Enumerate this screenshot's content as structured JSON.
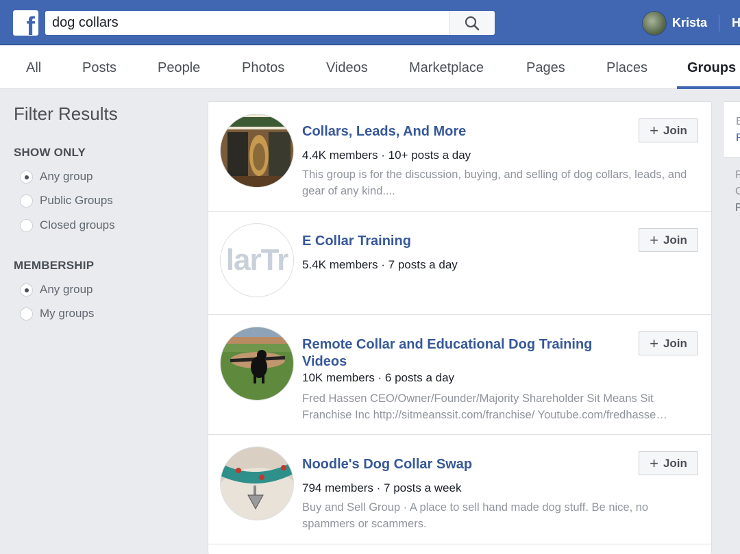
{
  "header": {
    "logo": "f",
    "search": {
      "value": "dog collars",
      "icon": "search-icon"
    },
    "user": {
      "name": "Krista"
    },
    "home_label": "H"
  },
  "tabs": [
    {
      "label": "All"
    },
    {
      "label": "Posts"
    },
    {
      "label": "People"
    },
    {
      "label": "Photos"
    },
    {
      "label": "Videos"
    },
    {
      "label": "Marketplace"
    },
    {
      "label": "Pages"
    },
    {
      "label": "Places"
    },
    {
      "label": "Groups",
      "active": true
    }
  ],
  "filter": {
    "title": "Filter Results",
    "show_only": {
      "label": "SHOW ONLY",
      "options": [
        "Any group",
        "Public Groups",
        "Closed groups"
      ],
      "selected": "Any group"
    },
    "membership": {
      "label": "MEMBERSHIP",
      "options": [
        "Any group",
        "My groups"
      ],
      "selected": "Any group"
    }
  },
  "results": [
    {
      "name": "Collars, Leads, And More",
      "meta": "4.4K members · 10+ posts a day",
      "description": "This group is for the discussion, buying, and selling of dog collars, leads, and gear of any kind....",
      "join_label": "Join"
    },
    {
      "name": "E Collar Training",
      "meta": "5.4K members · 7 posts a day",
      "description": "",
      "thumb_text": "larTr",
      "join_label": "Join"
    },
    {
      "name": "Remote Collar and Educational Dog Training Videos",
      "meta": "10K members · 6 posts a day",
      "description": "Fred Hassen CEO/Owner/Founder/Majority Shareholder Sit Means Sit Franchise Inc http://sitmeanssit.com/franchise/ Youtube.com/fredhasse…",
      "join_label": "Join"
    },
    {
      "name": "Noodle's Dog Collar Swap",
      "meta": "794 members · 7 posts a week",
      "description": "Buy and Sell Group · A place to sell hand made dog stuff. Be nice, no spammers or scammers.",
      "join_label": "Join"
    }
  ],
  "right_panel": {
    "chars": [
      "E",
      "F",
      "F",
      "C",
      "F"
    ]
  },
  "colors": {
    "brand_blue": "#4267b2",
    "link_blue": "#365899",
    "page_bg": "#e9ebee"
  }
}
